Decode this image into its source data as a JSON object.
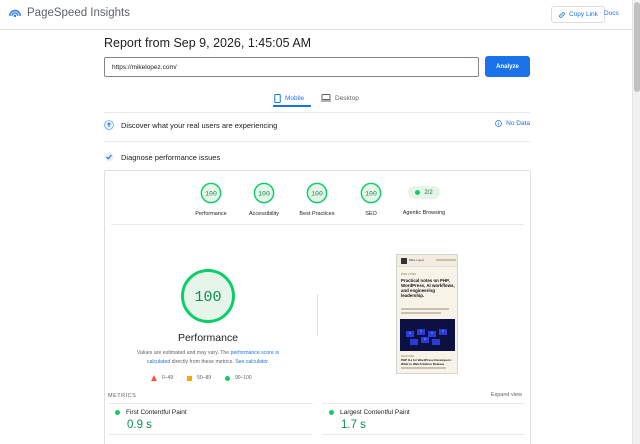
{
  "header": {
    "app_title": "PageSpeed Insights",
    "copy_link_label": "Copy Link",
    "docs_label": "Docs"
  },
  "report": {
    "title": "Report from Sep 9, 2026, 1:45:05 AM",
    "url_value": "https://mikelopez.com/",
    "analyze_label": "Analyze"
  },
  "tabs": [
    {
      "label": "Mobile",
      "selected": true
    },
    {
      "label": "Desktop",
      "selected": false
    }
  ],
  "sections": {
    "real_users_label": "Discover what your real users are experiencing",
    "no_data_label": "No Data",
    "diagnose_label": "Diagnose performance issues"
  },
  "scores": [
    {
      "label": "Performance",
      "value": "100"
    },
    {
      "label": "Accessibility",
      "value": "100"
    },
    {
      "label": "Best Practices",
      "value": "100"
    },
    {
      "label": "SEO",
      "value": "100"
    }
  ],
  "agentic": {
    "label": "Agentic Browsing",
    "value": "2/2"
  },
  "performance": {
    "score": "100",
    "label": "Performance",
    "disclaimer_pre": "Values are estimated and may vary. The ",
    "disclaimer_link1": "performance score is calculated",
    "disclaimer_mid": " directly from these metrics. ",
    "disclaimer_link2": "See calculator",
    "disclaimer_post": ".",
    "legend": [
      {
        "range": "0–49",
        "color": "#ff4e42"
      },
      {
        "range": "50–89",
        "color": "#ffa400"
      },
      {
        "range": "90–100",
        "color": "#0cce6b"
      }
    ]
  },
  "screenshot": {
    "site_name": "Mike Lopez",
    "kicker": "MIKE LOPEZ",
    "headline": "Practical notes on PHP, WordPress, AI workflows, and engineering leadership.",
    "caption_kicker": "FEATURED",
    "caption_title": "PHP 8.x for WordPress Developers: What to Watch Before Release"
  },
  "metrics": {
    "section_label": "METRICS",
    "expand_label": "Expand view",
    "items": [
      {
        "name": "First Contentful Paint",
        "value": "0.9 s"
      },
      {
        "name": "Largest Contentful Paint",
        "value": "1.7 s"
      }
    ]
  },
  "colors": {
    "accent": "#1a73e8",
    "pass": "#0cce6b",
    "pass_text": "#0d904f"
  }
}
